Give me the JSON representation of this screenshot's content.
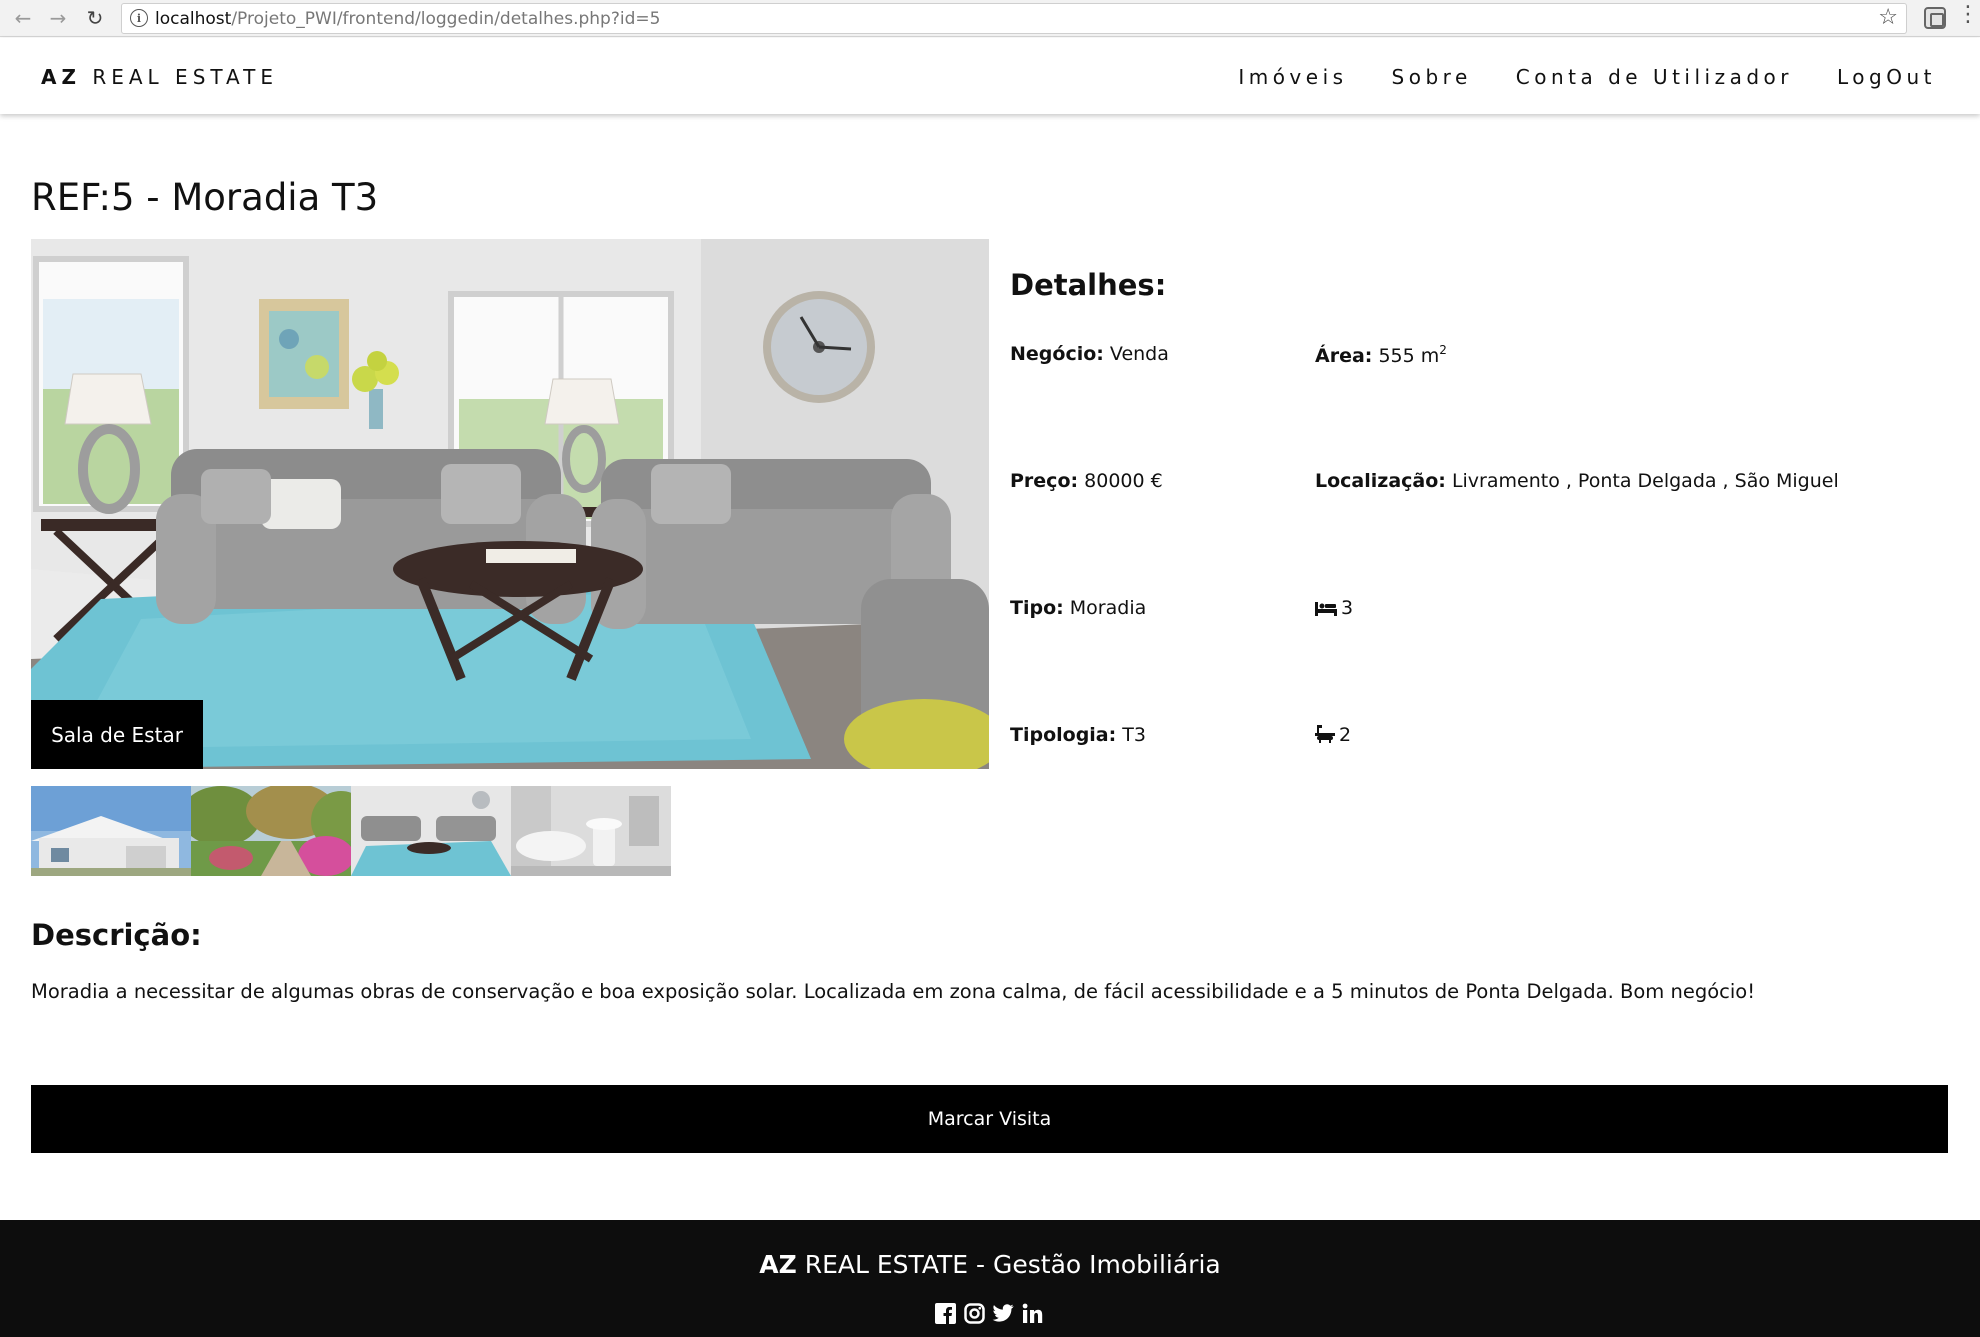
{
  "browser": {
    "back_icon": "arrow-left-icon",
    "forward_icon": "arrow-right-icon",
    "reload_icon": "reload-icon",
    "url_host": "localhost",
    "url_path": "/Projeto_PWI/frontend/loggedin/detalhes.php?id=5",
    "bookmark_icon": "star-icon"
  },
  "header": {
    "brand_bold": "AZ",
    "brand_rest": "REAL ESTATE",
    "menu": [
      {
        "label": "Imóveis"
      },
      {
        "label": "Sobre"
      },
      {
        "label": "Conta de Utilizador"
      },
      {
        "label": "LogOut"
      }
    ]
  },
  "property": {
    "title": "REF:5 - Moradia T3",
    "photo_caption": "Sala de Estar",
    "thumbnails": [
      "house-exterior",
      "garden",
      "living-room",
      "bathroom"
    ],
    "details_heading": "Detalhes:",
    "negocio_label": "Negócio:",
    "negocio_value": "Venda",
    "area_label": "Área:",
    "area_value": "555 m",
    "area_unit_sup": "2",
    "preco_label": "Preço:",
    "preco_value": "80000 €",
    "localizacao_label": "Localização:",
    "localizacao_value": "Livramento , Ponta Delgada , São Miguel",
    "tipo_label": "Tipo:",
    "tipo_value": "Moradia",
    "quartos_icon": "bed-icon",
    "quartos_value": "3",
    "tipologia_label": "Tipologia:",
    "tipologia_value": "T3",
    "wc_icon": "bathtub-icon",
    "wc_value": "2"
  },
  "description": {
    "heading": "Descrição:",
    "text": "Moradia a necessitar de algumas obras de conservação e boa exposição solar. Localizada em zona calma, de fácil acessibilidade e a 5 minutos de Ponta Delgada. Bom negócio!"
  },
  "visit_button": "Marcar Visita",
  "footer": {
    "brand_bold": "AZ",
    "brand_rest": "REAL ESTATE - Gestão Imobiliária",
    "socials": [
      "facebook-icon",
      "instagram-icon",
      "twitter-icon",
      "linkedin-icon"
    ]
  },
  "colors": {
    "accent": "#000000",
    "footer_bg": "#0d0d0d",
    "rug": "#6ec3d3"
  }
}
